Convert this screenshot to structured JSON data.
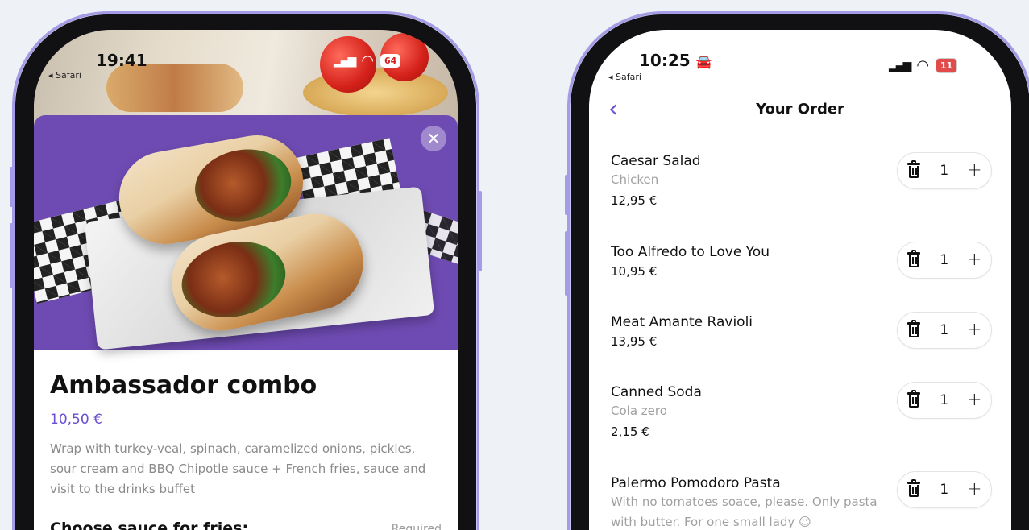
{
  "left_phone": {
    "status": {
      "time": "19:41",
      "back_label": "◂ Safari",
      "battery": "64"
    },
    "product": {
      "title": "Ambassador combo",
      "price": "10,50 €",
      "description": "Wrap with turkey-veal, spinach, caramelized onions, pickles, sour cream and BBQ Chipotle sauce + French fries, sauce and visit to the drinks buffet",
      "sauce_heading": "Choose sauce for fries:",
      "required_label": "Required"
    },
    "close_label": "✕"
  },
  "right_phone": {
    "status": {
      "time": "10:25",
      "back_label": "◂ Safari",
      "battery": "11"
    },
    "nav": {
      "back_label": "‹",
      "title": "Your Order"
    },
    "order_items": [
      {
        "name": "Caesar Salad",
        "note": "Chicken",
        "price": "12,95 €",
        "qty": "1"
      },
      {
        "name": "Too Alfredo to Love You",
        "note": "",
        "price": "10,95 €",
        "qty": "1"
      },
      {
        "name": "Meat Amante Ravioli",
        "note": "",
        "price": "13,95 €",
        "qty": "1"
      },
      {
        "name": "Canned Soda",
        "note": "Cola zero",
        "price": "2,15 €",
        "qty": "1"
      },
      {
        "name": "Palermo Pomodoro Pasta",
        "note": "With no tomatoes soace, please. Only pasta with butter. For one small lady 😉",
        "price": "",
        "qty": "1"
      }
    ],
    "plus_label": "+"
  },
  "colors": {
    "accent": "#6c4fd0",
    "hero_purple": "#6e4bb2",
    "phone_frame": "#a59ce8",
    "battery_low": "#e24b4b"
  },
  "icons": [
    "signal-icon",
    "wifi-icon",
    "battery-icon",
    "car-icon",
    "close-icon",
    "chevron-left-icon",
    "trash-icon",
    "plus-icon"
  ]
}
